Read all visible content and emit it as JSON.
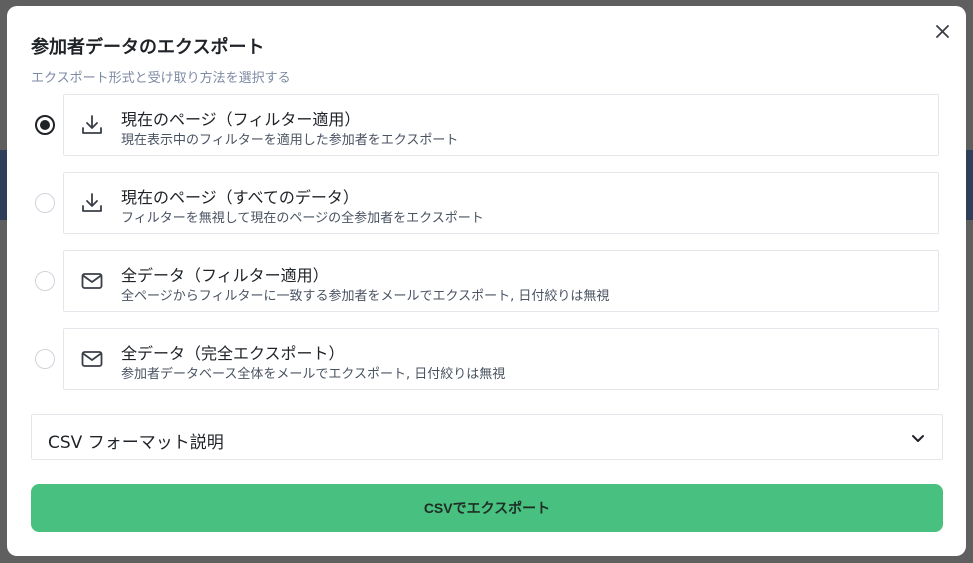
{
  "dialog": {
    "title": "参加者データのエクスポート",
    "subtitle": "エクスポート形式と受け取り方法を選択する"
  },
  "options": [
    {
      "label": "現在のページ（フィルター適用）",
      "description": "現在表示中のフィルターを適用した参加者をエクスポート",
      "icon": "download-icon",
      "selected": true
    },
    {
      "label": "現在のページ（すべてのデータ）",
      "description": "フィルターを無視して現在のページの全参加者をエクスポート",
      "icon": "download-icon",
      "selected": false
    },
    {
      "label": "全データ（フィルター適用）",
      "description": "全ページからフィルターに一致する参加者をメールでエクスポート, 日付絞りは無視",
      "icon": "mail-icon",
      "selected": false
    },
    {
      "label": "全データ（完全エクスポート）",
      "description": "参加者データベース全体をメールでエクスポート, 日付絞りは無視",
      "icon": "mail-icon",
      "selected": false
    }
  ],
  "accordion": {
    "label": "CSV フォーマット説明",
    "icon": "chevron-down-icon"
  },
  "export_button": {
    "label": "CSVでエクスポート",
    "color": "#48c07f"
  },
  "close_icon": "close-icon"
}
